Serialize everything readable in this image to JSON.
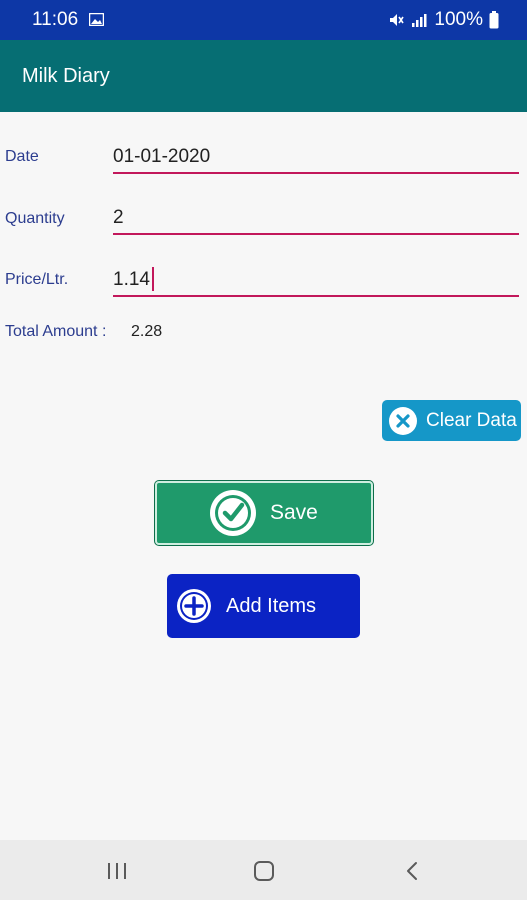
{
  "status_bar": {
    "time": "11:06",
    "battery_text": "100%",
    "icons": [
      "gallery-icon",
      "mute-icon",
      "signal-icon",
      "battery-icon"
    ]
  },
  "app_bar": {
    "title": "Milk Diary"
  },
  "form": {
    "date_label": "Date",
    "date_value": "01-01-2020",
    "quantity_label": "Quantity",
    "quantity_value": "2",
    "price_label": "Price/Ltr.",
    "price_value": "1.14",
    "total_label": "Total Amount :",
    "total_value": "2.28"
  },
  "buttons": {
    "clear_label": "Clear Data",
    "save_label": "Save",
    "add_label": "Add Items"
  },
  "nav_bar": {
    "icons": [
      "recent-apps-icon",
      "home-icon",
      "back-icon"
    ]
  },
  "colors": {
    "status_bar": "#0d37a6",
    "app_bar": "#066e73",
    "label_text": "#2c3d8f",
    "input_underline": "#c2185b",
    "clear_button": "#1597c8",
    "save_button": "#1f9a6b",
    "add_button": "#0b23c4"
  }
}
